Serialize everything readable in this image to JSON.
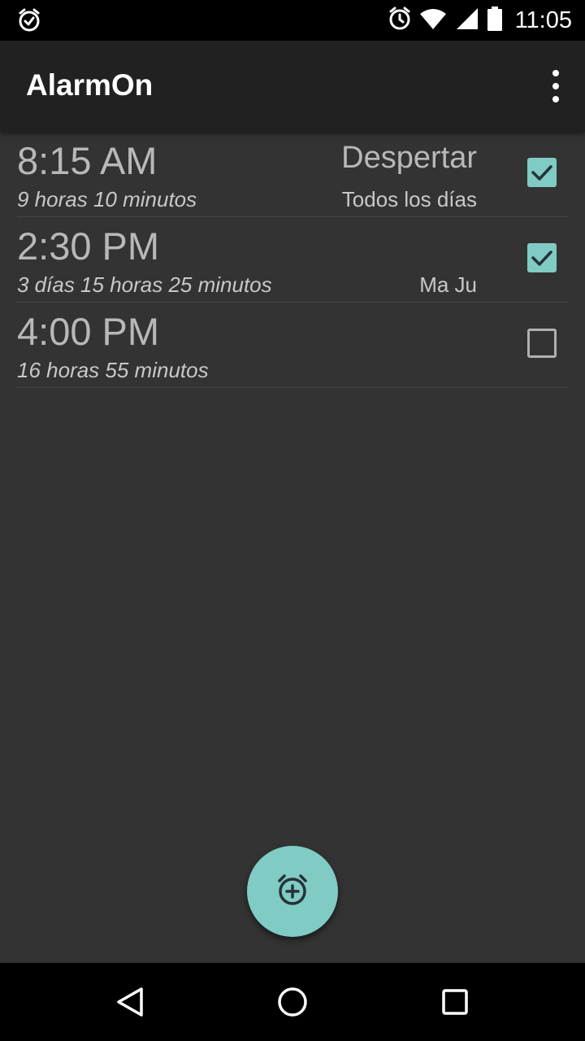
{
  "status_bar": {
    "time": "11:05",
    "icons": [
      "alarm-check-icon",
      "alarm-clock-icon",
      "wifi-icon",
      "signal-icon",
      "battery-icon"
    ]
  },
  "app_bar": {
    "title": "AlarmOn",
    "menu_icon": "more-vert-icon"
  },
  "alarms": [
    {
      "time": "8:15 AM",
      "remaining": "9 horas 10 minutos",
      "label": "Despertar",
      "days": "Todos los días",
      "enabled": true
    },
    {
      "time": "2:30 PM",
      "remaining": "3 días 15 horas 25 minutos",
      "label": "",
      "days": "Ma Ju",
      "enabled": true
    },
    {
      "time": "4:00 PM",
      "remaining": "16 horas 55 minutos",
      "label": "",
      "days": "",
      "enabled": false
    }
  ],
  "fab": {
    "icon": "add-alarm-icon"
  },
  "nav_bar": {
    "icons": [
      "back-icon",
      "home-icon",
      "recents-icon"
    ]
  },
  "colors": {
    "accent": "#80cbc4",
    "background": "#333333",
    "app_bar": "#212121"
  }
}
